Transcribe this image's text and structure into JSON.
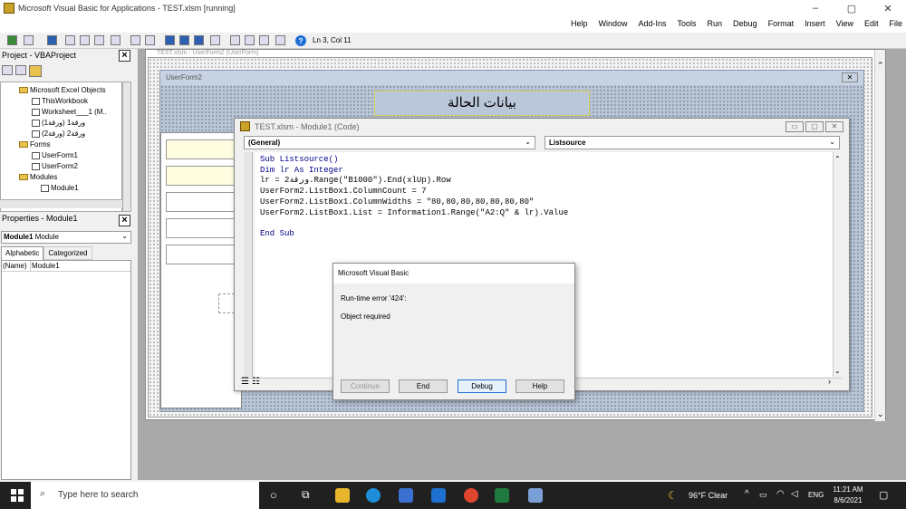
{
  "window": {
    "title": "Microsoft Visual Basic for Applications - TEST.xlsm [running]",
    "minimize": "–",
    "restore": "▢",
    "close": "✕"
  },
  "menu": [
    "File",
    "Edit",
    "View",
    "Insert",
    "Format",
    "Debug",
    "Run",
    "Tools",
    "Add-Ins",
    "Window",
    "Help"
  ],
  "toolbar": {
    "position": "Ln 3, Col 11"
  },
  "project": {
    "title": "Project - VBAProject",
    "items": [
      "Microsoft Excel Objects",
      "ThisWorkbook",
      "Worksheet___1 (M..",
      "(ورقة1 (ورقة1",
      "(ورقة2 (ورقة2",
      "Forms",
      "UserForm1",
      "UserForm2",
      "Modules",
      "Module1"
    ]
  },
  "properties": {
    "title": "Properties - Module1",
    "object": "Module1",
    "object_type": "Module",
    "tabs": [
      "Alphabetic",
      "Categorized"
    ],
    "row_name": "(Name)",
    "row_value": "Module1"
  },
  "userform_designer": {
    "back_title": "TEST.xlsm - UserForm2 (UserForm)",
    "form_caption": "UserForm2",
    "label_text": "بيانات الحالة"
  },
  "code_window": {
    "title": "TEST.xlsm - Module1 (Code)",
    "object_dropdown": "(General)",
    "proc_dropdown": "Listsource",
    "lines": [
      "Sub Listsource()",
      "Dim lr As Integer",
      "lr = ورقة2.Range(\"B1000\").End(xlUp).Row",
      "UserForm2.ListBox1.ColumnCount = 7",
      "UserForm2.ListBox1.ColumnWidths = \"80,80,80,80,80,80,80\"",
      "UserForm2.ListBox1.List = Information1.Range(\"A2:Q\" & lr).Value",
      "",
      "End Sub"
    ]
  },
  "error_dialog": {
    "title": "Microsoft Visual Basic",
    "error": "Run-time error '424':",
    "message": "Object required",
    "buttons": {
      "continue": "Continue",
      "end": "End",
      "debug": "Debug",
      "help": "Help"
    }
  },
  "taskbar": {
    "search_placeholder": "Type here to search",
    "weather": "96°F  Clear",
    "lang": "ENG",
    "time": "11:21 AM",
    "date": "8/6/2021"
  },
  "colors": {
    "accent": "#1e6ed6",
    "taskbar": "#202020",
    "keyword": "#00008b",
    "formbg": "#b9c7d9"
  }
}
